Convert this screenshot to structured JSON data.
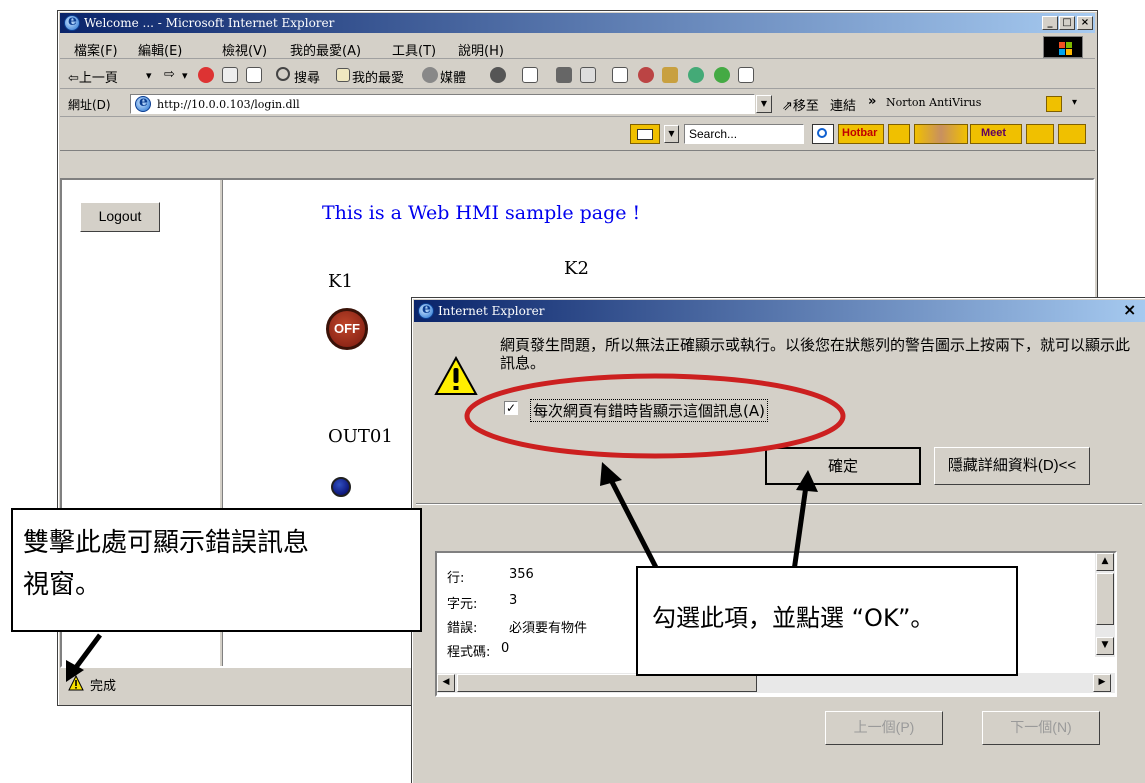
{
  "window": {
    "title": "Welcome ... - Microsoft Internet Explorer",
    "caption_minimize": "_",
    "caption_maximize": "□",
    "caption_close": "×"
  },
  "menu": [
    "檔案(F)",
    "編輯(E)",
    "檢視(V)",
    "我的最愛(A)",
    "工具(T)",
    "說明(H)"
  ],
  "toolbar": {
    "back": "⇦上一頁",
    "search": "搜尋",
    "favorites": "我的最愛",
    "media": "媒體"
  },
  "address": {
    "label": "網址(D)",
    "url": "http://10.0.0.103/login.dll",
    "go": "移至",
    "links": "連結",
    "links_chevron": "»",
    "norton": "Norton AntiVirus"
  },
  "linksbar": {
    "search_placeholder": "Search...",
    "hotbar": "Hotbar",
    "meet": "Meet"
  },
  "page": {
    "logout": "Logout",
    "heading": "This is a Web HMI sample page !",
    "k1": "K1",
    "k2": "K2",
    "off": "OFF",
    "out01": "OUT01"
  },
  "status": {
    "text": "完成"
  },
  "dialog": {
    "title": "Internet Explorer",
    "close": "×",
    "message": "網頁發生問題，所以無法正確顯示或執行。以後您在狀態列的警告圖示上按兩下，就可以顯示此訊息。",
    "checkbox_label": "每次網頁有錯時皆顯示這個訊息(A)",
    "checkbox_checked": true,
    "ok": "確定",
    "hide_details": "隱藏詳細資料(D)<<",
    "details": [
      {
        "key": "行:",
        "value": "356"
      },
      {
        "key": "字元:",
        "value": "3"
      },
      {
        "key": "錯誤:",
        "value": "必須要有物件"
      },
      {
        "key": "程式碼:",
        "value": "0"
      }
    ],
    "prev": "上一個(P)",
    "next": "下一個(N)"
  },
  "callouts": {
    "left": "雙擊此處可顯示錯誤訊息視窗。",
    "right": "勾選此項，並點選 “OK”。"
  },
  "colors": {
    "title_gradient_start": "#0a246a",
    "title_gradient_end": "#a6caf0",
    "annotation_red": "#cc2020",
    "heading_blue": "#0000ee"
  }
}
